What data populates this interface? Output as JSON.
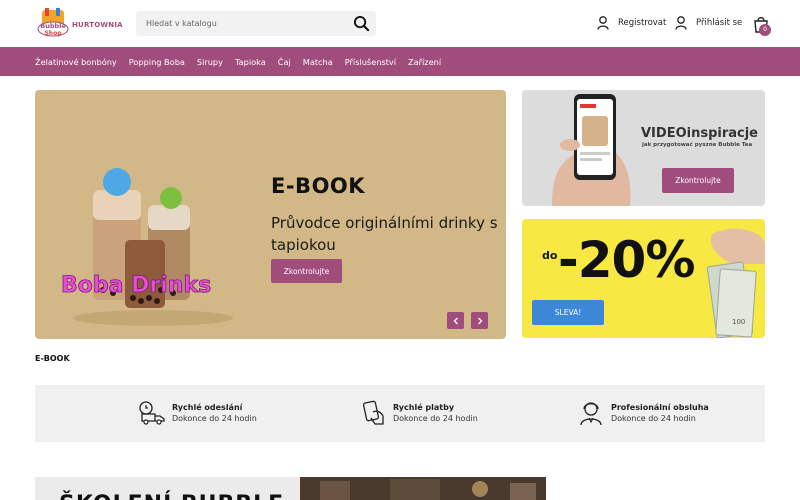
{
  "header": {
    "logo_text": "HURTOWNIA",
    "logo_badge_text": "Bubble Shop",
    "search_placeholder": "Hledat v katalogu",
    "register_label": "Registrovat",
    "login_label": "Přihlásit se",
    "cart_count": "0"
  },
  "nav": {
    "items": [
      "Želatinové bonbóny",
      "Popping Boba",
      "Sirupy",
      "Tapioka",
      "Čaj",
      "Matcha",
      "Příslušenství",
      "Zařízení"
    ]
  },
  "hero": {
    "title": "E-BOOK",
    "subtitle": "Průvodce originálními drinky s tapiokou",
    "art_text": "Boba Drinks",
    "button_label": "Zkontrolujte",
    "prev_icon": "chevron-left-icon",
    "next_icon": "chevron-right-icon",
    "caption": "E-BOOK",
    "background_color": "#d2b886"
  },
  "promo_video": {
    "title": "VIDEOinspiracje",
    "subtitle": "jak przygotować pyszne Bubble Tea",
    "button_label": "Zkontrolujte"
  },
  "promo_sale": {
    "prefix": "do",
    "value": "-20%",
    "button_label": "SLEVA!",
    "background_color": "#f7e843",
    "button_color": "#3d87d9"
  },
  "features": [
    {
      "icon": "delivery-truck-icon",
      "title": "Rychlé odeslání",
      "subtitle": "Dokonce do 24 hodin"
    },
    {
      "icon": "payment-hand-icon",
      "title": "Rychlé platby",
      "subtitle": "Dokonce do 24 hodin"
    },
    {
      "icon": "support-agent-icon",
      "title": "Profesionální obsluha",
      "subtitle": "Dokonce do 24 hodin"
    }
  ],
  "bottom_banner": {
    "title": "ŠKOLENÍ BUBBLE"
  },
  "colors": {
    "accent": "#a04c7c",
    "feature_bg": "#f0f0f0"
  }
}
